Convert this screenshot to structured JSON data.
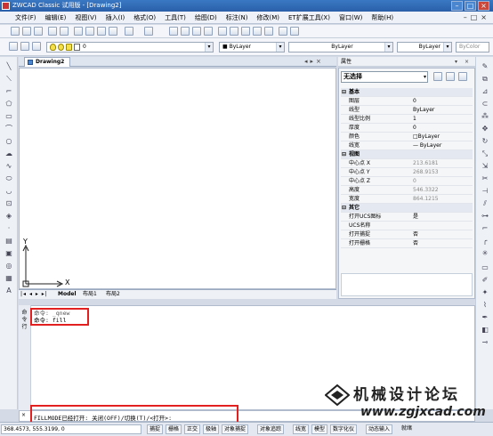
{
  "window": {
    "title": "ZWCAD Classic 试用版 - [Drawing2]",
    "controls": [
      "minimize",
      "maximize",
      "close"
    ]
  },
  "menu": [
    "文件(F)",
    "编辑(E)",
    "视图(V)",
    "插入(I)",
    "格式(O)",
    "工具(T)",
    "绘图(D)",
    "标注(N)",
    "修改(M)",
    "ET扩展工具(X)",
    "窗口(W)",
    "帮助(H)"
  ],
  "toolbar": {
    "layer_value": "0",
    "color_value": "■ ByLayer",
    "linetype_value": "ByLayer",
    "lineweight_value": "ByLayer",
    "plotstyle_value": "ByColor"
  },
  "drawing": {
    "tab_label": "Drawing2",
    "axis_y": "Y",
    "axis_x": "X",
    "layout_tabs": [
      "Model",
      "布局1",
      "布局2"
    ]
  },
  "properties": {
    "header": "属性",
    "selection": "无选择",
    "groups": [
      {
        "name": "基本",
        "rows": [
          {
            "k": "图层",
            "v": "0"
          },
          {
            "k": "线型",
            "v": "ByLayer"
          },
          {
            "k": "线型比例",
            "v": "1"
          },
          {
            "k": "厚度",
            "v": "0"
          },
          {
            "k": "颜色",
            "v": "□ByLayer"
          },
          {
            "k": "线宽",
            "v": "— ByLayer"
          }
        ]
      },
      {
        "name": "视图",
        "rows": [
          {
            "k": "中心点 X",
            "v": "213.6181"
          },
          {
            "k": "中心点 Y",
            "v": "268.9153"
          },
          {
            "k": "中心点 Z",
            "v": "0"
          },
          {
            "k": "高度",
            "v": "546.3322"
          },
          {
            "k": "宽度",
            "v": "864.1215"
          }
        ]
      },
      {
        "name": "其它",
        "rows": [
          {
            "k": "打开UCS图标",
            "v": "是"
          },
          {
            "k": "UCS名称",
            "v": ""
          },
          {
            "k": "打开捕捉",
            "v": "否"
          },
          {
            "k": "打开栅格",
            "v": "否"
          }
        ]
      }
    ]
  },
  "command": {
    "side_label": "命令行",
    "lines": [
      "命令: _qnew",
      "命令: fill"
    ],
    "prompt": "FILLMODE已经打开: 关闭(OFF)/切换(T)/<打开>:"
  },
  "status": {
    "coords": "368.4573,  555.3199,  0",
    "buttons": [
      "捕捉",
      "栅格",
      "正交",
      "极轴",
      "对象捕捉",
      "对象追踪",
      "线宽",
      "模型",
      "数字化仪",
      "动态输入",
      "就绪"
    ]
  },
  "watermark": {
    "line1": "机械设计论坛",
    "line2": "www.zgjxcad.com"
  },
  "colors": {
    "title": "#2a5fa8",
    "highlight": "#e32020"
  }
}
